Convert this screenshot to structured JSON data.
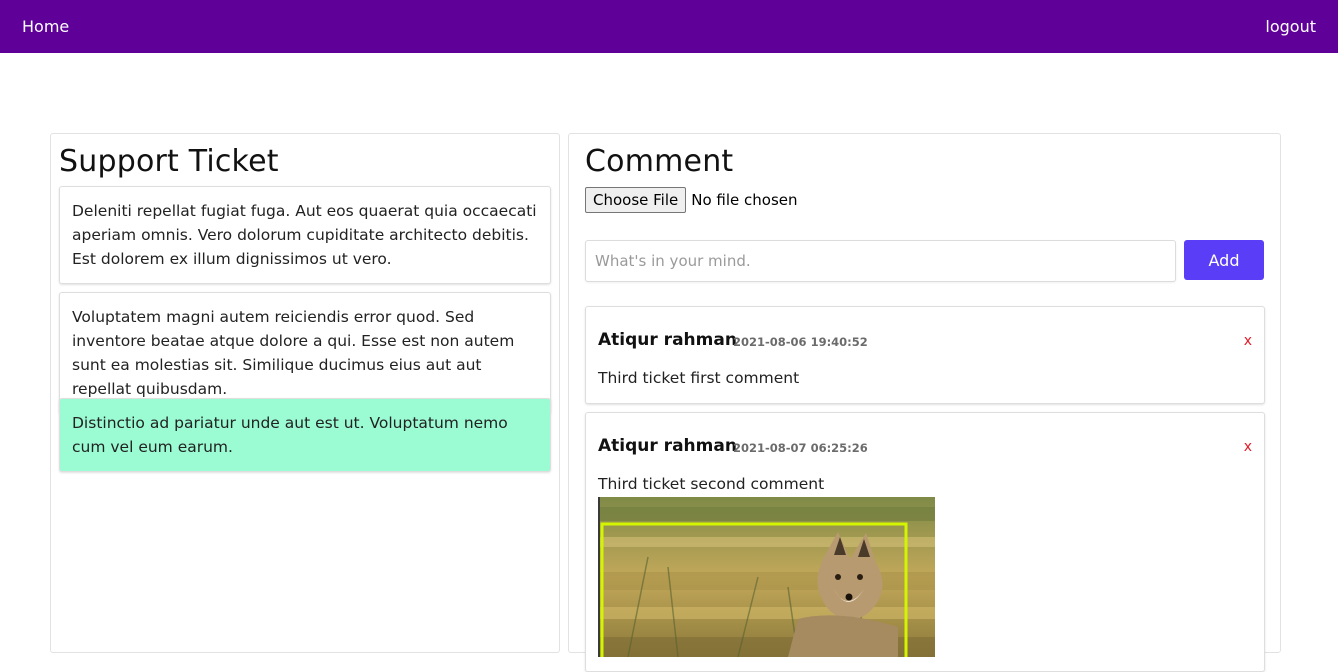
{
  "nav": {
    "home_label": "Home",
    "logout_label": "logout"
  },
  "tickets_panel": {
    "title": "Support Ticket",
    "tickets": [
      {
        "text": "Deleniti repellat fugiat fuga. Aut eos quaerat quia occaecati aperiam omnis. Vero dolorum cupiditate architecto debitis. Est dolorem ex illum dignissimos ut vero."
      },
      {
        "text": "Voluptatem magni autem reiciendis error quod. Sed inventore beatae atque dolore a qui. Esse est non autem sunt ea molestias sit. Similique ducimus eius aut aut repellat quibusdam."
      },
      {
        "text": "Distinctio ad pariatur unde aut est ut. Voluptatum nemo cum vel eum earum."
      }
    ]
  },
  "comment_panel": {
    "title": "Comment",
    "file_button_label": "Choose File",
    "file_status": "No file chosen",
    "input_placeholder": "What's in your mind.",
    "add_label": "Add",
    "comments": [
      {
        "author": "Atiqur rahman",
        "timestamp": "2021-08-06 19:40:52",
        "text": "Third ticket first comment",
        "delete_label": "x"
      },
      {
        "author": "Atiqur rahman",
        "timestamp": "2021-08-07 06:25:26",
        "text": "Third ticket second comment",
        "delete_label": "x"
      }
    ]
  },
  "colors": {
    "navbar": "#5f0099",
    "active_ticket": "#9bfcd4",
    "add_button": "#5a3df7",
    "delete_link": "#e0202a",
    "image_box_outline": "#d4f500"
  },
  "icons": {
    "comment_image": "fox-photo"
  }
}
